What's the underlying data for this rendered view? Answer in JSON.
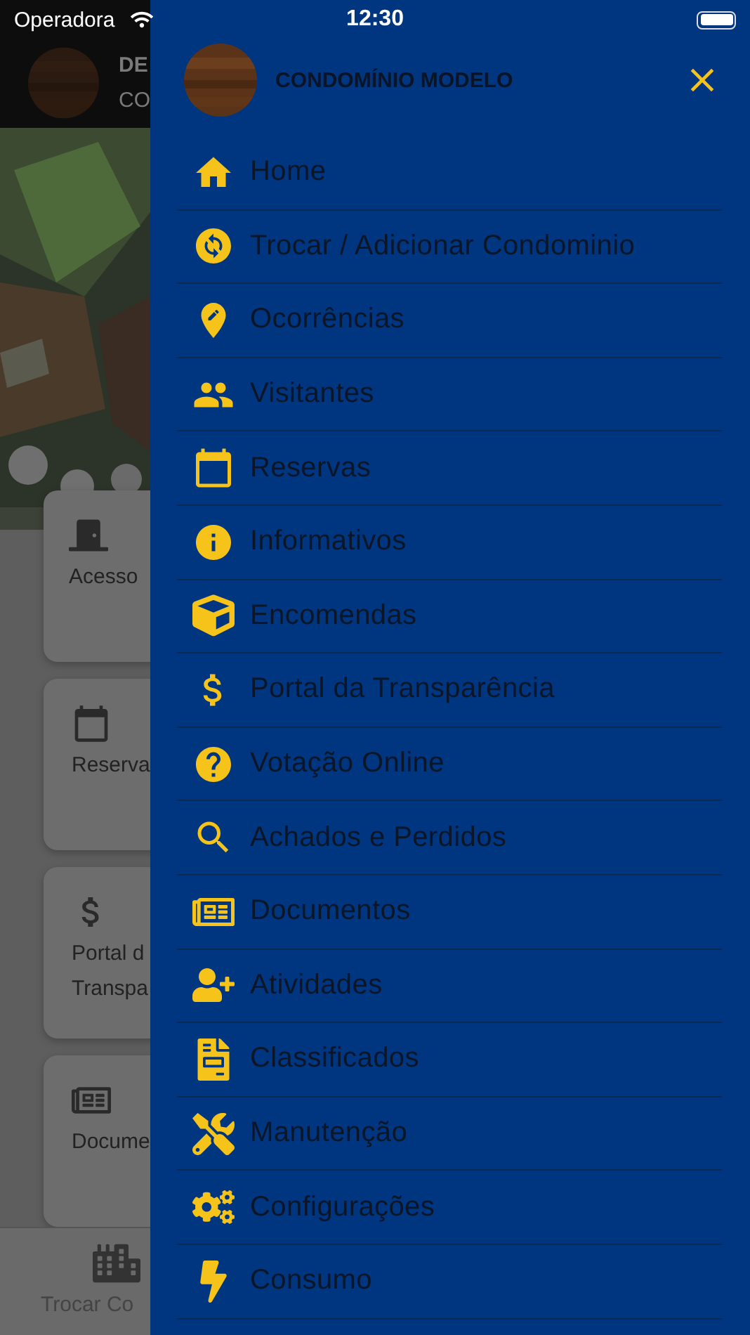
{
  "status_bar": {
    "carrier": "Operadora",
    "time": "12:30"
  },
  "background": {
    "header": {
      "title": "DE",
      "subtitle": "CO"
    },
    "cards": [
      {
        "lines": [
          "Acesso"
        ]
      },
      {
        "lines": [
          "Reserva"
        ]
      },
      {
        "lines": [
          "Portal d",
          "Transpa"
        ]
      },
      {
        "lines": [
          "Docume"
        ]
      }
    ],
    "tab": {
      "label": "Trocar Co"
    }
  },
  "drawer": {
    "title": "CONDOMÍNIO MODELO",
    "items": [
      {
        "label": "Home"
      },
      {
        "label": "Trocar / Adicionar Condominio"
      },
      {
        "label": "Ocorrências"
      },
      {
        "label": "Visitantes"
      },
      {
        "label": "Reservas"
      },
      {
        "label": "Informativos"
      },
      {
        "label": "Encomendas"
      },
      {
        "label": "Portal da Transparência"
      },
      {
        "label": "Votação Online"
      },
      {
        "label": "Achados e Perdidos"
      },
      {
        "label": "Documentos"
      },
      {
        "label": "Atividades"
      },
      {
        "label": "Classificados"
      },
      {
        "label": "Manutenção"
      },
      {
        "label": "Configurações"
      },
      {
        "label": "Consumo"
      }
    ]
  }
}
